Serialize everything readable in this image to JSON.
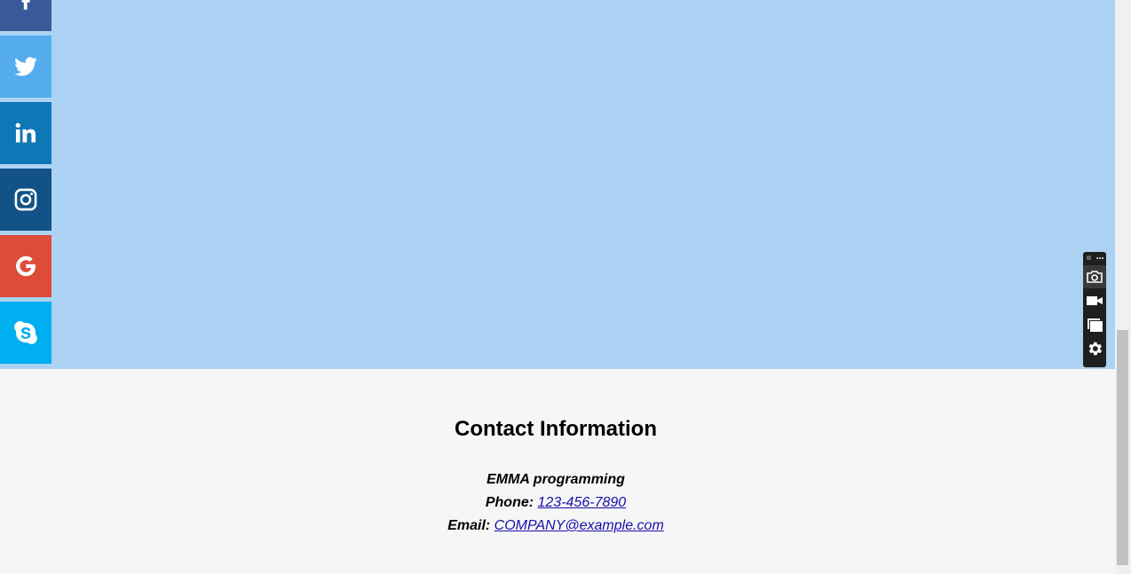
{
  "social_bar": {
    "items": [
      {
        "network": "facebook",
        "icon": "facebook-icon",
        "color": "#3b5a9a"
      },
      {
        "network": "twitter",
        "icon": "twitter-icon",
        "color": "#55acee"
      },
      {
        "network": "linkedin",
        "icon": "linkedin-icon",
        "color": "#0e77b5"
      },
      {
        "network": "instagram",
        "icon": "instagram-icon",
        "color": "#135287"
      },
      {
        "network": "google",
        "icon": "google-icon",
        "color": "#dd4b39"
      },
      {
        "network": "skype",
        "icon": "skype-icon",
        "color": "#00aff0"
      }
    ]
  },
  "hero": {
    "background": "#acd3f3"
  },
  "contact": {
    "title": "Contact Information",
    "company": "EMMA programming",
    "phone_label": "Phone:",
    "phone": "123-456-7890",
    "email_label": "Email:",
    "email": "COMPANY@example.com"
  },
  "capture_toolbar": {
    "buttons": [
      "screenshot-icon",
      "video-icon",
      "window-icon",
      "settings-icon"
    ]
  }
}
